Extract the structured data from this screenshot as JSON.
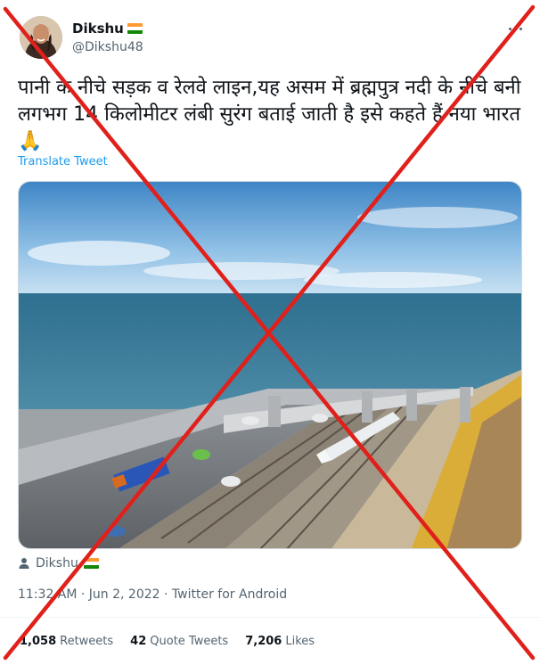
{
  "tweet": {
    "display_name": "Dikshu",
    "handle": "@Dikshu48",
    "text": "पानी के नीचे सड़क व रेलवे लाइन,यह असम में ब्रह्मपुत्र नदी के नीचे बनी लगभग 14 किलोमीटर लंबी सुरंग बताई जाती है इसे कहते हैं नया भारत 🙏",
    "translate_label": "Translate Tweet",
    "via_name": "Dikshu",
    "timestamp": "11:32 AM · Jun 2, 2022 · Twitter for Android",
    "stats": [
      {
        "count": "1,058",
        "label": "Retweets"
      },
      {
        "count": "42",
        "label": "Quote Tweets"
      },
      {
        "count": "7,206",
        "label": "Likes"
      }
    ]
  },
  "icons": {
    "more": "more-horizontal-icon",
    "person": "person-icon",
    "flag": "india-flag-icon"
  },
  "colors": {
    "cross": "#e0201b",
    "link": "#1d9bf0",
    "muted": "#536471"
  }
}
